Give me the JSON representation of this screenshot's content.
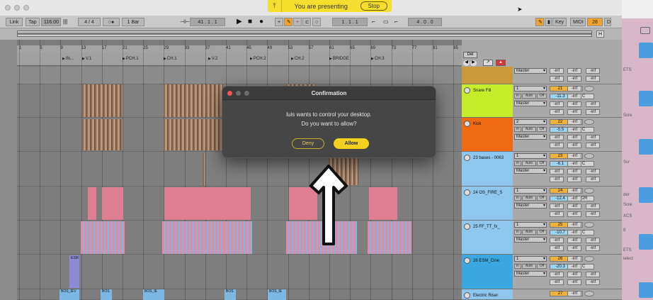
{
  "presenting": {
    "text": "You are presenting",
    "stop_label": "Stop"
  },
  "transport": {
    "link": "Link",
    "tap": "Tap",
    "tempo": "116.00",
    "signature": "4 / 4",
    "metronome": "○●",
    "quantize": "1 Bar",
    "position": "41 .  1 .  1",
    "loop_start": "1 .  1 .  1",
    "loop_length": "4 .  0 .  0",
    "key": "Key",
    "midi": "MIDI",
    "cpu": "28 %",
    "d": "D"
  },
  "overview": {
    "h_label": "H",
    "w_label": "W"
  },
  "ruler": {
    "bars": [
      "1",
      "5",
      "9",
      "13",
      "17",
      "21",
      "25",
      "29",
      "33",
      "37",
      "41",
      "45",
      "49",
      "53",
      "57",
      "61",
      "65",
      "69",
      "73",
      "77",
      "81",
      "85"
    ],
    "del_label": "Del"
  },
  "locators": [
    "IN...",
    "V.1",
    "PCH.1",
    "CH.1",
    "V.2",
    "PCH.2",
    "CH.2",
    "BRIDGE",
    "CH.3"
  ],
  "dialog": {
    "title": "Confirmation",
    "line1": "luis wants to control your desktop.",
    "line2": "Do you want to allow?",
    "deny": "Deny",
    "allow": "Allow"
  },
  "tracks": [
    {
      "name": "",
      "color": "#c99a3a",
      "route": "Master",
      "num": "",
      "vol": "",
      "pan": ""
    },
    {
      "name": "Snare Fill",
      "color": "#c6ec2a",
      "route": "Master",
      "input": "1",
      "num": "21",
      "vol": "-11.3",
      "pan": "C"
    },
    {
      "name": "Kick",
      "color": "#f06a12",
      "route": "Master",
      "input": "2",
      "num": "22",
      "vol": "-5.5",
      "pan": "C"
    },
    {
      "name": "23 bases - 0063",
      "color": "#8ec6ee",
      "route": "Master",
      "input": "1",
      "num": "23",
      "vol": "-6.1",
      "pan": "C"
    },
    {
      "name": "24 OS_FIRE_S",
      "color": "#8ec6ee",
      "route": "Master",
      "input": "1",
      "num": "24",
      "vol": "-12.4",
      "pan": "22R"
    },
    {
      "name": "25 FF_TT_fx_",
      "color": "#8ec6ee",
      "route": "Master",
      "input": "1",
      "num": "25",
      "vol": "-10.7",
      "pan": "C"
    },
    {
      "name": "26 ESM_Cine",
      "color": "#3aa7e0",
      "route": "Master",
      "input": "1",
      "num": "26",
      "vol": "-20.3",
      "pan": "C"
    },
    {
      "name": "Electric Riser",
      "color": "#8ec6ee",
      "route": "",
      "num": "27",
      "vol": "",
      "pan": ""
    }
  ],
  "mixer_labels": {
    "inf": "-inf",
    "solo": "S",
    "in": "In",
    "auto": "Auto",
    "off": "Off"
  },
  "clip_labels": {
    "esm": "ESM",
    "bos1": "BOS_IEV",
    "bos2": "BOS",
    "bos3": "BOS_IE",
    "bos4": "BOS",
    "bos5": "BOS_IE"
  },
  "desktop_texts": [
    "ETS",
    "Scre",
    "Scr",
    "der",
    "Scre",
    "XCS",
    "8",
    "ETS",
    "ielect"
  ]
}
